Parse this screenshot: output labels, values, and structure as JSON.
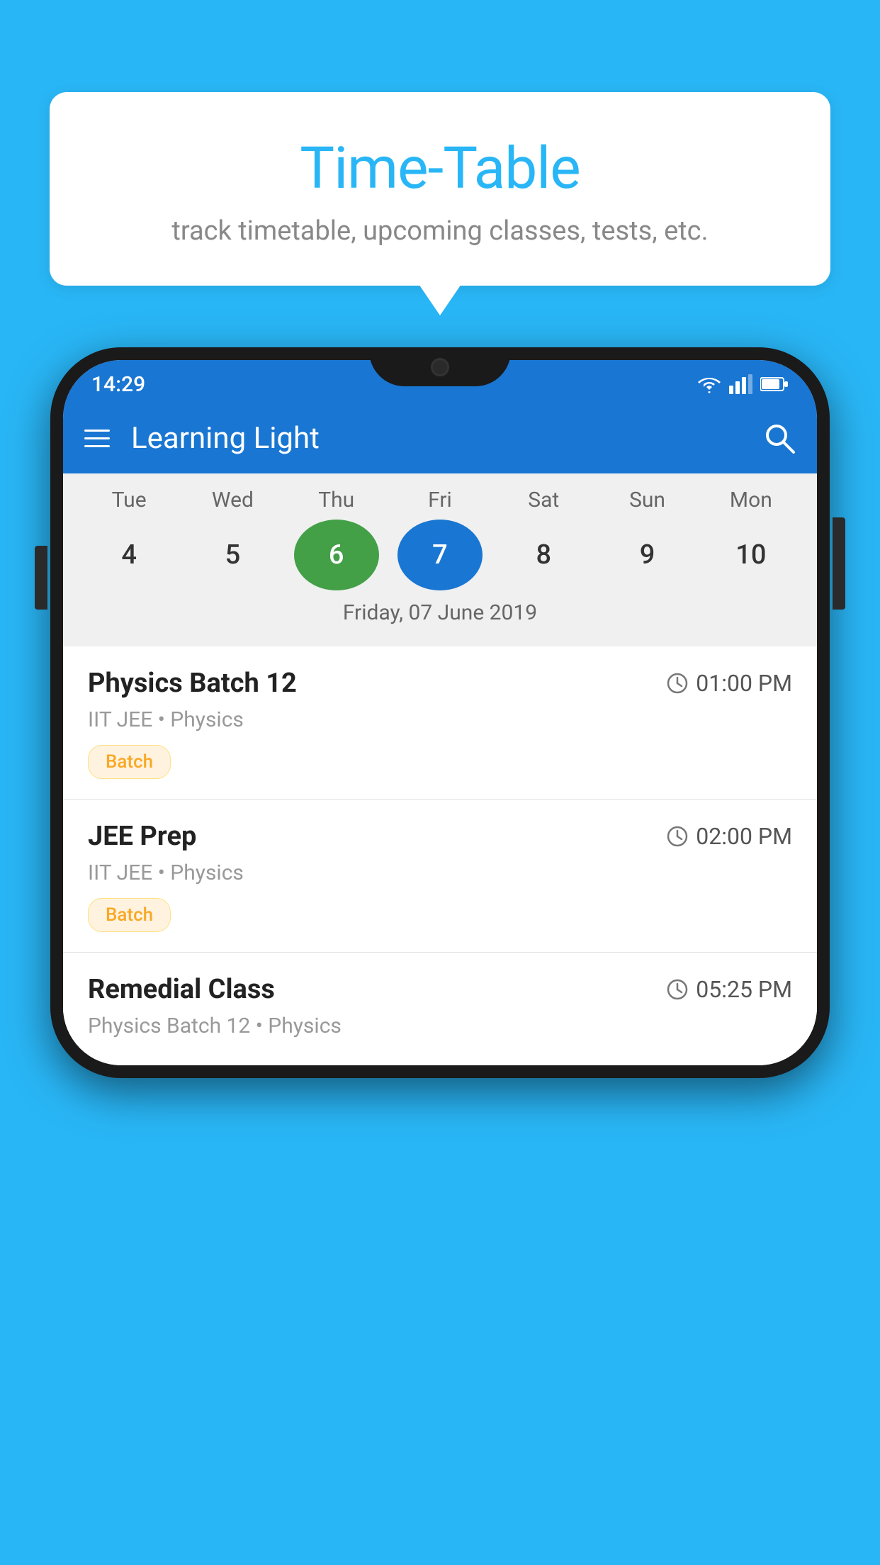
{
  "page": {
    "background_color": "#29B6F6"
  },
  "tooltip": {
    "title": "Time-Table",
    "subtitle": "track timetable, upcoming classes, tests, etc."
  },
  "phone": {
    "status_bar": {
      "time": "14:29"
    },
    "app_bar": {
      "title": "Learning Light"
    },
    "calendar": {
      "days": [
        {
          "name": "Tue",
          "num": "4",
          "state": "normal"
        },
        {
          "name": "Wed",
          "num": "5",
          "state": "normal"
        },
        {
          "name": "Thu",
          "num": "6",
          "state": "today"
        },
        {
          "name": "Fri",
          "num": "7",
          "state": "selected"
        },
        {
          "name": "Sat",
          "num": "8",
          "state": "normal"
        },
        {
          "name": "Sun",
          "num": "9",
          "state": "normal"
        },
        {
          "name": "Mon",
          "num": "10",
          "state": "normal"
        }
      ],
      "selected_date_label": "Friday, 07 June 2019"
    },
    "schedule": [
      {
        "title": "Physics Batch 12",
        "time": "01:00 PM",
        "subtitle": "IIT JEE • Physics",
        "tag": "Batch"
      },
      {
        "title": "JEE Prep",
        "time": "02:00 PM",
        "subtitle": "IIT JEE • Physics",
        "tag": "Batch"
      },
      {
        "title": "Remedial Class",
        "time": "05:25 PM",
        "subtitle": "Physics Batch 12 • Physics",
        "tag": null
      }
    ]
  }
}
